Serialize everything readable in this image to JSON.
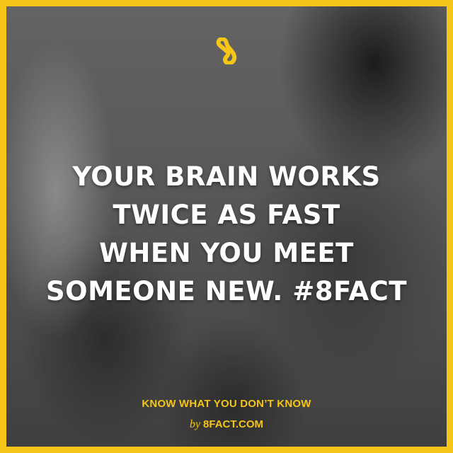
{
  "brand": {
    "accent_color": "#f5c518",
    "logo_icon": "infinity-8-icon"
  },
  "fact": {
    "lines": [
      "YOUR BRAIN WORKS",
      "TWICE AS FAST",
      "WHEN YOU MEET",
      "SOMEONE NEW. #8FACT"
    ]
  },
  "footer": {
    "tagline": "KNOW WHAT YOU DON’T KNOW",
    "by_word": "by",
    "site": "8FACT.COM"
  }
}
